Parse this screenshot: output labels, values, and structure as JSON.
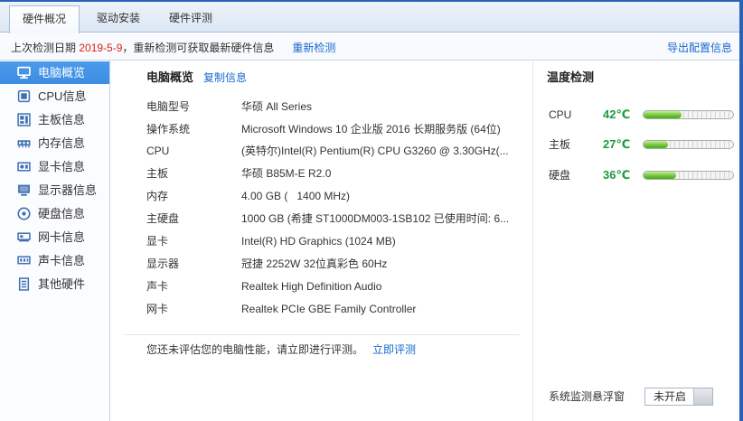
{
  "colors": {
    "accent": "#2a62b8",
    "link": "#1769cf",
    "date": "#e0201b",
    "temp": "#1f9a3f",
    "selected": "#3b8de3"
  },
  "tabs": [
    {
      "label": "硬件概况",
      "active": true
    },
    {
      "label": "驱动安装",
      "active": false
    },
    {
      "label": "硬件评测",
      "active": false
    }
  ],
  "info_bar": {
    "prefix": "上次检测日期 ",
    "date": "2019-5-9",
    "suffix": "，重新检测可获取最新硬件信息",
    "recheck_link": "重新检测",
    "export_link": "导出配置信息"
  },
  "sidebar": {
    "items": [
      {
        "label": "电脑概览",
        "icon": "computer-icon",
        "selected": true
      },
      {
        "label": "CPU信息",
        "icon": "cpu-icon",
        "selected": false
      },
      {
        "label": "主板信息",
        "icon": "motherboard-icon",
        "selected": false
      },
      {
        "label": "内存信息",
        "icon": "memory-icon",
        "selected": false
      },
      {
        "label": "显卡信息",
        "icon": "graphics-card-icon",
        "selected": false
      },
      {
        "label": "显示器信息",
        "icon": "display-icon",
        "selected": false
      },
      {
        "label": "硬盘信息",
        "icon": "hard-disk-icon",
        "selected": false
      },
      {
        "label": "网卡信息",
        "icon": "network-card-icon",
        "selected": false
      },
      {
        "label": "声卡信息",
        "icon": "sound-card-icon",
        "selected": false
      },
      {
        "label": "其他硬件",
        "icon": "other-hardware-icon",
        "selected": false
      }
    ]
  },
  "overview": {
    "title": "电脑概览",
    "copy_link": "复制信息",
    "rows": [
      {
        "label": "电脑型号",
        "value": "华硕 All Series"
      },
      {
        "label": "操作系统",
        "value": "Microsoft Windows 10 企业版 2016 长期服务版 (64位)"
      },
      {
        "label": "CPU",
        "value": "(英特尔)Intel(R) Pentium(R) CPU G3260 @ 3.30GHz(..."
      },
      {
        "label": "主板",
        "value": "华硕 B85M-E R2.0"
      },
      {
        "label": "内存",
        "value": "4.00 GB (   1400 MHz)"
      },
      {
        "label": "主硬盘",
        "value": "1000 GB (希捷 ST1000DM003-1SB102 已使用时间: 6..."
      },
      {
        "label": "显卡",
        "value": "Intel(R) HD Graphics (1024 MB)"
      },
      {
        "label": "显示器",
        "value": "冠捷 2252W 32位真彩色 60Hz"
      },
      {
        "label": "声卡",
        "value": "Realtek High Definition Audio"
      },
      {
        "label": "网卡",
        "value": "Realtek PCIe GBE Family Controller"
      }
    ]
  },
  "evaluation": {
    "text": "您还未评估您的电脑性能，请立即进行评测。",
    "link": "立即评测"
  },
  "temperature": {
    "title": "温度检测",
    "unit": "℃",
    "sensors": [
      {
        "label": "CPU",
        "value": 42
      },
      {
        "label": "主板",
        "value": 27
      },
      {
        "label": "硬盘",
        "value": 36
      }
    ]
  },
  "float_window": {
    "label": "系统监测悬浮窗",
    "toggle_state": "未开启"
  }
}
